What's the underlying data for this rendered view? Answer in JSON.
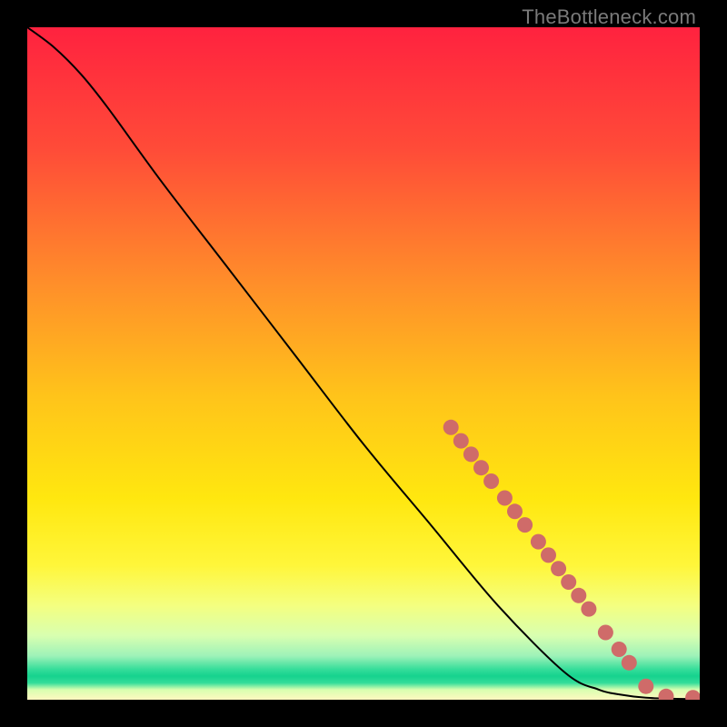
{
  "watermark": "TheBottleneck.com",
  "chart_data": {
    "type": "line",
    "title": "",
    "xlabel": "",
    "ylabel": "",
    "xlim": [
      0,
      100
    ],
    "ylim": [
      0,
      100
    ],
    "grid": false,
    "legend": false,
    "series": [
      {
        "name": "curve",
        "style": "line",
        "color": "#000000",
        "x": [
          0,
          4,
          8,
          12,
          20,
          30,
          40,
          50,
          60,
          70,
          80,
          85,
          88,
          92,
          96,
          100
        ],
        "y": [
          100,
          97,
          93,
          88,
          77,
          64,
          51,
          38,
          26,
          14,
          4,
          1.5,
          0.8,
          0.3,
          0.15,
          0.1
        ]
      },
      {
        "name": "markers",
        "style": "scatter",
        "color": "#cf6b69",
        "points": [
          {
            "x": 63,
            "y": 40.5
          },
          {
            "x": 64.5,
            "y": 38.5
          },
          {
            "x": 66,
            "y": 36.5
          },
          {
            "x": 67.5,
            "y": 34.5
          },
          {
            "x": 69,
            "y": 32.5
          },
          {
            "x": 71,
            "y": 30.0
          },
          {
            "x": 72.5,
            "y": 28.0
          },
          {
            "x": 74,
            "y": 26.0
          },
          {
            "x": 76,
            "y": 23.5
          },
          {
            "x": 77.5,
            "y": 21.5
          },
          {
            "x": 79,
            "y": 19.5
          },
          {
            "x": 80.5,
            "y": 17.5
          },
          {
            "x": 82,
            "y": 15.5
          },
          {
            "x": 83.5,
            "y": 13.5
          },
          {
            "x": 86,
            "y": 10.0
          },
          {
            "x": 88,
            "y": 7.5
          },
          {
            "x": 89.5,
            "y": 5.5
          },
          {
            "x": 92,
            "y": 2.0
          },
          {
            "x": 95,
            "y": 0.5
          },
          {
            "x": 99,
            "y": 0.3
          }
        ]
      }
    ],
    "background_gradient": {
      "stops": [
        {
          "offset": 0.0,
          "color": "#ff223f"
        },
        {
          "offset": 0.18,
          "color": "#ff4b38"
        },
        {
          "offset": 0.38,
          "color": "#ff8e2a"
        },
        {
          "offset": 0.55,
          "color": "#ffc41a"
        },
        {
          "offset": 0.7,
          "color": "#ffe70f"
        },
        {
          "offset": 0.8,
          "color": "#fff63a"
        },
        {
          "offset": 0.86,
          "color": "#f4ff80"
        },
        {
          "offset": 0.905,
          "color": "#d8ffb0"
        },
        {
          "offset": 0.935,
          "color": "#9df2b8"
        },
        {
          "offset": 0.955,
          "color": "#34dd9a"
        },
        {
          "offset": 0.965,
          "color": "#16d28e"
        },
        {
          "offset": 0.975,
          "color": "#34dd9a"
        },
        {
          "offset": 0.985,
          "color": "#d8ffb0"
        },
        {
          "offset": 1.0,
          "color": "#fff9c0"
        }
      ]
    }
  }
}
